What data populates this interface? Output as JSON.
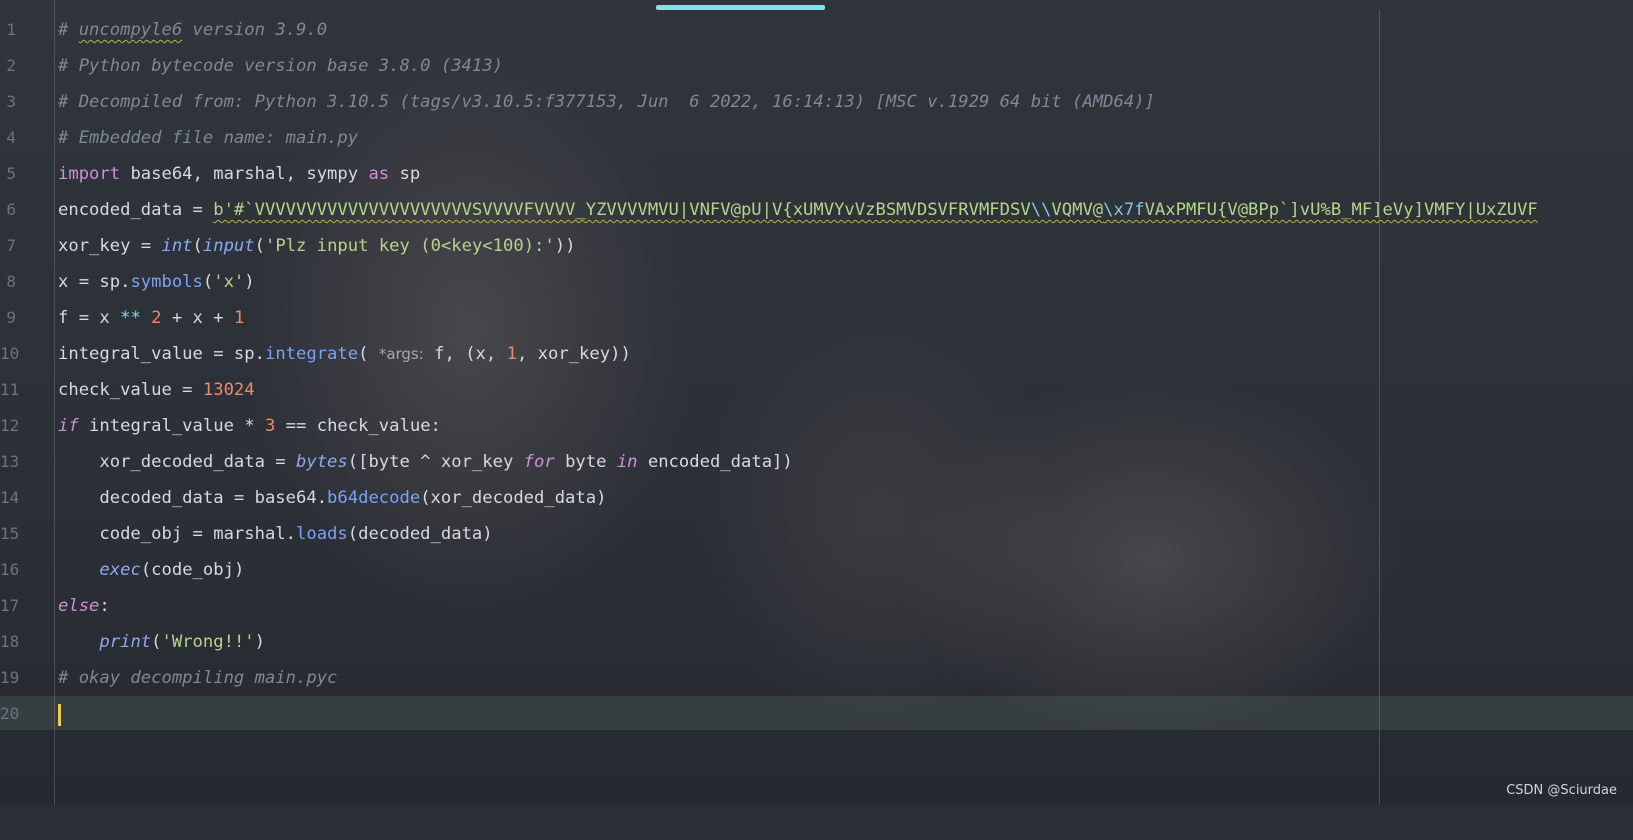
{
  "editor": {
    "line_numbers": [
      "1",
      "2",
      "3",
      "4",
      "5",
      "6",
      "7",
      "8",
      "9",
      "10",
      "11",
      "12",
      "13",
      "14",
      "15",
      "16",
      "17",
      "18",
      "19",
      "20"
    ],
    "lines": [
      {
        "comment": "# uncompyle6 version 3.9.0"
      },
      {
        "comment": "# Python bytecode version base 3.8.0 (3413)"
      },
      {
        "comment": "# Decompiled from: Python 3.10.5 (tags/v3.10.5:f377153, Jun  6 2022, 16:14:13) [MSC v.1929 64 bit (AMD64)]"
      },
      {
        "comment": "# Embedded file name: main.py"
      },
      {
        "import_kw": "import",
        "modules": " base64, marshal, sympy ",
        "as_kw": "as",
        "alias": " sp"
      },
      {
        "var": "encoded_data = ",
        "bytes_prefix": "b'#`VVVVVVVVVVVVVVVVVVVVVSVVVVFVVVV_YZVVVVMVU|VNFV@pU|V{xUMVYvVzBSMVDSVFRVMFDSV",
        "escape1": "\\\\",
        "bytes_mid": "VQMV@",
        "escape2": "\\x7f",
        "bytes_tail": "VAxPMFU{V@BPp`]vU%B_MF]eVy]VMFY|UxZUVF"
      },
      {
        "var": "xor_key = ",
        "int_fn": "int",
        "input_fn": "input",
        "prompt": "'Plz input key (0<key<100):'"
      },
      {
        "var": "x = sp.",
        "method": "symbols",
        "arg": "'x'"
      },
      {
        "text": "f = x ** 2 + x + 1"
      },
      {
        "var": "integral_value = sp.",
        "method": "integrate",
        "hint": "*args:",
        "args_a": " f, (x, ",
        "num": "1",
        "args_b": ", xor_key))"
      },
      {
        "var": "check_value = ",
        "num": "13024"
      },
      {
        "if_kw": "if",
        "cond_a": " integral_value * ",
        "num": "3",
        "cond_b": " == check_value:"
      },
      {
        "var": "    xor_decoded_data = ",
        "fn": "bytes",
        "expr_a": "([byte ^ xor_key ",
        "for_kw": "for",
        "expr_b": " byte ",
        "in_kw": "in",
        "expr_c": " encoded_data])"
      },
      {
        "var": "    decoded_data = base64.",
        "method": "b64decode",
        "args": "(xor_decoded_data)"
      },
      {
        "var": "    code_obj = marshal.",
        "method": "loads",
        "args": "(decoded_data)"
      },
      {
        "indent": "    ",
        "fn": "exec",
        "args": "(code_obj)"
      },
      {
        "else_kw": "else",
        "colon": ":"
      },
      {
        "indent": "    ",
        "fn": "print",
        "arg": "'Wrong!!'"
      },
      {
        "comment": "# okay decompiling main.pyc"
      },
      {
        "text": ""
      }
    ]
  },
  "watermark": "CSDN @Sciurdae"
}
